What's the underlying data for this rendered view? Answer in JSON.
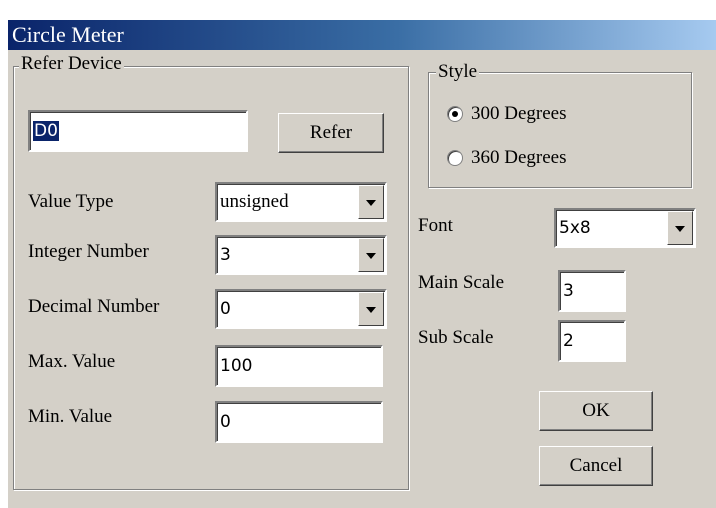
{
  "window": {
    "title": "Circle Meter"
  },
  "refer_device": {
    "legend": "Refer Device",
    "device_value": "D0",
    "refer_button": "Refer",
    "value_type": {
      "label": "Value Type",
      "selected": "unsigned"
    },
    "integer_number": {
      "label": "Integer Number",
      "selected": "3"
    },
    "decimal_number": {
      "label": "Decimal Number",
      "selected": "0"
    },
    "max_value": {
      "label": "Max. Value",
      "value": "100"
    },
    "min_value": {
      "label": "Min. Value",
      "value": "0"
    }
  },
  "style": {
    "legend": "Style",
    "options": [
      {
        "label": "300 Degrees",
        "selected": true
      },
      {
        "label": "360 Degrees",
        "selected": false
      }
    ]
  },
  "font": {
    "label": "Font",
    "selected": "5x8"
  },
  "main_scale": {
    "label": "Main Scale",
    "value": "3"
  },
  "sub_scale": {
    "label": "Sub Scale",
    "value": "2"
  },
  "buttons": {
    "ok": "OK",
    "cancel": "Cancel"
  },
  "colors": {
    "face": "#d4d0c8",
    "title_start": "#0a246a",
    "title_end": "#a6caf0"
  }
}
